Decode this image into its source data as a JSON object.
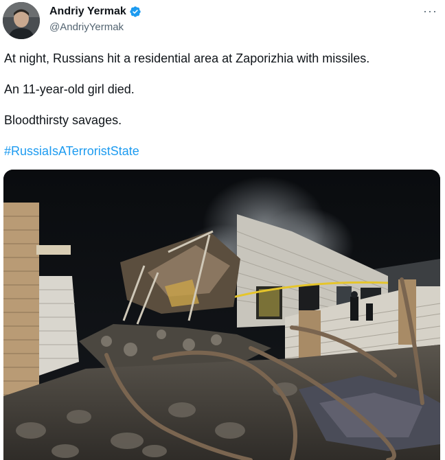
{
  "author": {
    "display_name": "Andriy Yermak",
    "handle": "@AndriyYermak",
    "verified_icon": "verified-badge-icon",
    "avatar_icon": "avatar"
  },
  "menu": {
    "more_label": "···",
    "more_icon": "more-options-icon"
  },
  "tweet": {
    "line1": "At night, Russians hit a residential area at Zaporizhia with missiles.",
    "line2": "An 11-year-old girl died.",
    "line3": "Bloodthirsty savages.",
    "hashtag": "#RussiaIsATerroristState"
  },
  "colors": {
    "text": "#0f1419",
    "secondary": "#536471",
    "link": "#1d9bf0",
    "verified": "#1d9bf0"
  },
  "media": {
    "type": "photo"
  }
}
